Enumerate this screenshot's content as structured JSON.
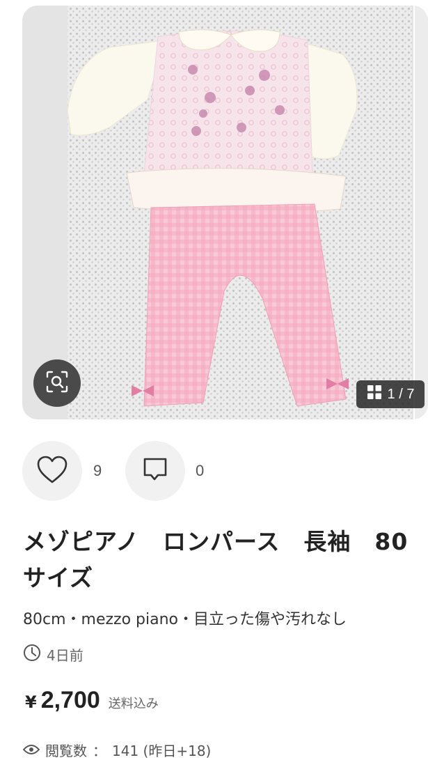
{
  "gallery": {
    "page_indicator": "1 / 7",
    "image_alt": "メゾピアノ ロンパース 写真"
  },
  "social": {
    "likes": "9",
    "comments": "0"
  },
  "item": {
    "title": "メゾピアノ　ロンパース　長袖　80\nサイズ",
    "description": "80cm・mezzo piano・目立った傷や汚れなし",
    "posted": "4日前",
    "price_currency": "¥",
    "price": "2,700",
    "shipping": "送料込み",
    "views_label": "閲覧数",
    "views_value": "141 (昨日+18)"
  },
  "colors": {
    "accent_pink": "#f4b8c8",
    "background": "#ffffff"
  }
}
